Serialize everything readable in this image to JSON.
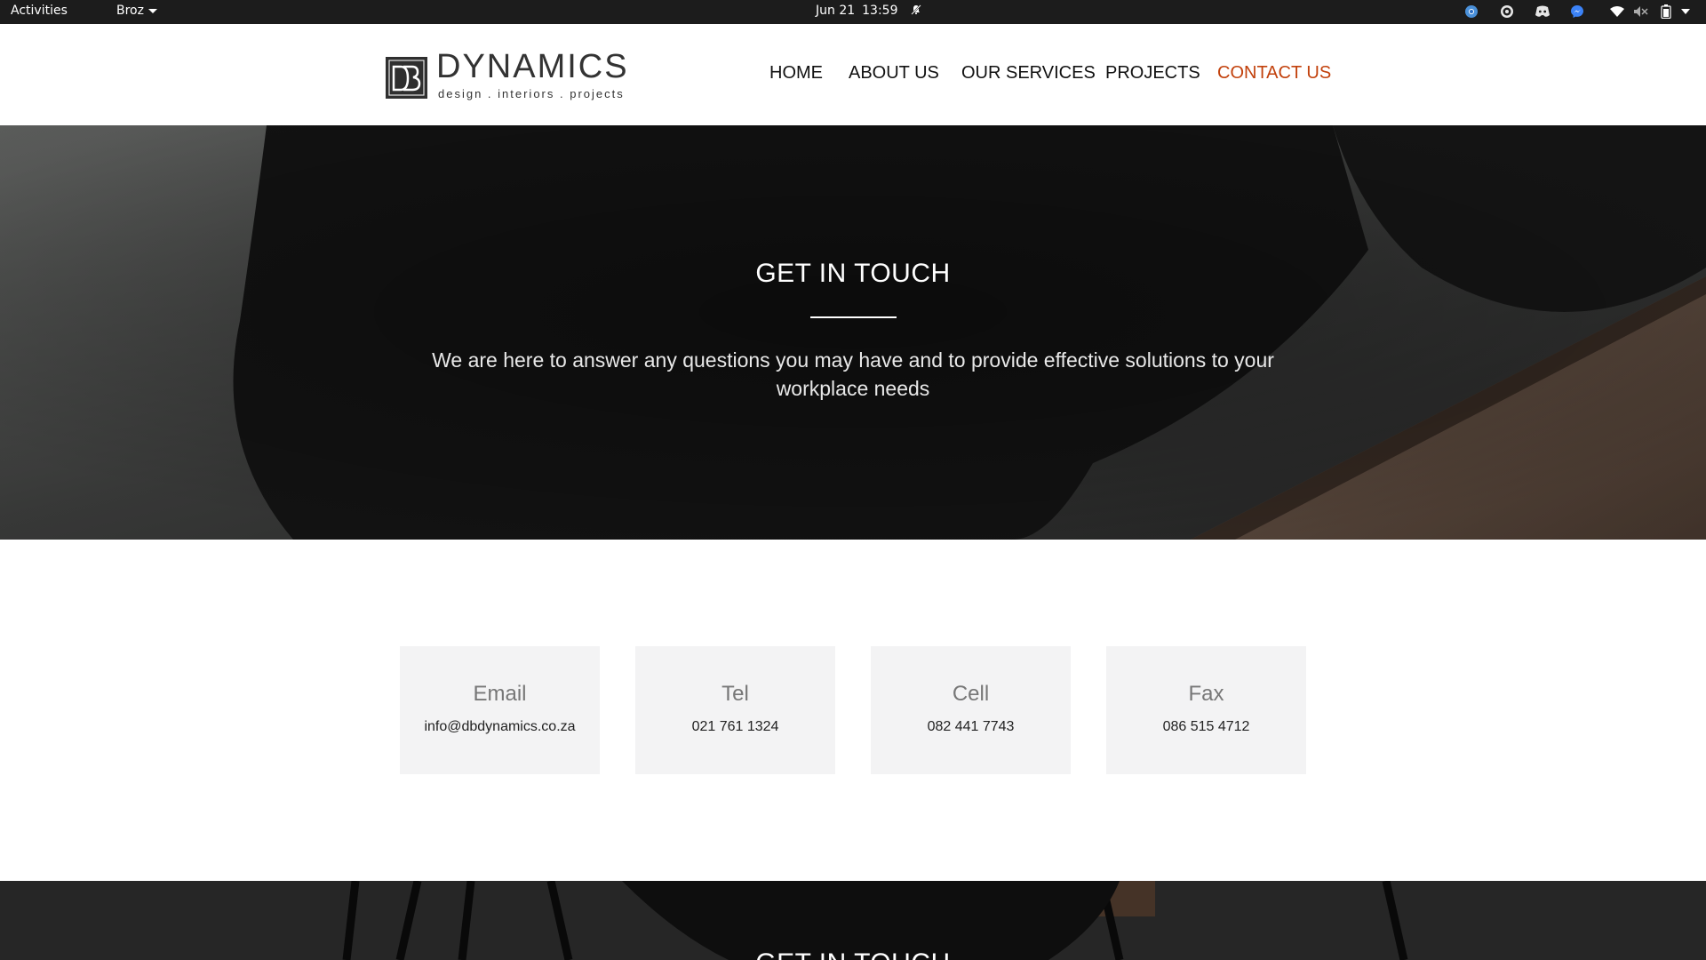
{
  "system_bar": {
    "activities": "Activities",
    "app_name": "Broz",
    "date": "Jun 21",
    "time": "13:59",
    "tray_icons": [
      "chrome-icon",
      "obs-icon",
      "discord-icon",
      "messenger-icon",
      "wifi-icon",
      "volume-muted-icon",
      "battery-icon",
      "system-menu-caret-icon"
    ]
  },
  "site": {
    "logo_word": "DYNAMICS",
    "logo_tagline": "design . interiors . projects",
    "nav": [
      {
        "label": "HOME"
      },
      {
        "label": "ABOUT US"
      },
      {
        "label": "OUR SERVICES"
      },
      {
        "label": "PROJECTS"
      },
      {
        "label": "CONTACT US",
        "active": true
      }
    ],
    "accent_color": "#c2410c"
  },
  "hero": {
    "title": "GET IN TOUCH",
    "text": "We are here to answer any questions you may have and to provide effective solutions to your workplace needs"
  },
  "contacts": [
    {
      "title": "Email",
      "value": "info@dbdynamics.co.za"
    },
    {
      "title": "Tel",
      "value": "021 761 1324"
    },
    {
      "title": "Cell",
      "value": "082 441 7743"
    },
    {
      "title": "Fax",
      "value": "086 515 4712"
    }
  ],
  "footer_section": {
    "title": "GET IN TOUCH"
  }
}
